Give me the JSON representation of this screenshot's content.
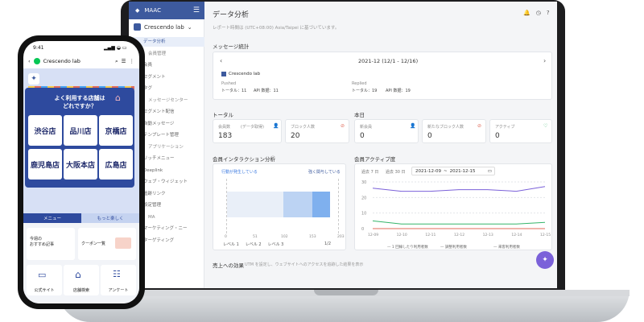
{
  "laptop": {
    "sidebar": {
      "app_name": "MAAC",
      "workspace": "Crescendo lab",
      "items": [
        {
          "label": "データ分析",
          "active": true
        },
        {
          "label": "会員管理"
        },
        {
          "label": "会員"
        },
        {
          "label": "セグメント"
        },
        {
          "label": "タグ"
        },
        {
          "label": "メッセージセンター"
        },
        {
          "label": "セグメント配信"
        },
        {
          "label": "自動メッセージ"
        },
        {
          "label": "テンプレート管理"
        },
        {
          "label": "アプリケーション"
        },
        {
          "label": "リッチメニュー"
        },
        {
          "label": "Deeplink"
        },
        {
          "label": "ウェブ・ウィジェット"
        },
        {
          "label": "追跡リンク"
        },
        {
          "label": "設定管理"
        },
        {
          "label": "MA"
        },
        {
          "label": "マーケティング・ニー"
        },
        {
          "label": "ターゲティング"
        }
      ]
    },
    "header": {
      "title": "データ分析",
      "subtitle": "レポート時間は (UTC+08:00) Asia/Taipei に基づいています。"
    },
    "message_stats": {
      "title": "メッセージ統計",
      "period": "2021-12 (12/1 - 12/16)",
      "brand": "Crescendo lab",
      "pushed_label": "Pushed",
      "pushed_total": "トータル：11",
      "pushed_api": "API 数据：11",
      "replied_label": "Replied",
      "replied_total": "トータル：19",
      "replied_api": "API 数据：19"
    },
    "totals": {
      "title": "トータル",
      "cards": [
        {
          "label": "会員数",
          "hint": "(データ取得)",
          "value": "183"
        },
        {
          "label": "ブロック人数",
          "value": "20"
        }
      ]
    },
    "today": {
      "title": "本日",
      "cards": [
        {
          "label": "新会員",
          "value": "0"
        },
        {
          "label": "新たなブロック人数",
          "value": "0"
        },
        {
          "label": "アクティブ",
          "value": "0"
        }
      ]
    },
    "interaction": {
      "title": "会員インタラクション分析",
      "legend_left": "行動が発生している",
      "legend_right": "強く関与している",
      "axis": [
        "0",
        "51",
        "102",
        "153",
        "203"
      ],
      "levels": [
        "レベル 1",
        "レベル 2",
        "レベル 3"
      ],
      "pager": "1/2"
    },
    "activity": {
      "title": "会員アクティブ度",
      "ranges": [
        "過去 7 日",
        "過去 30 日"
      ],
      "date_from": "2021-12-09",
      "date_to": "2021-12-15",
      "y_ticks": [
        "30",
        "20",
        "10",
        "0"
      ],
      "x_ticks": [
        "12-09",
        "12-10",
        "12-11",
        "12-12",
        "12-13",
        "12-14",
        "12-15"
      ],
      "legend": [
        "1 回線したり利用者数",
        "調整利用者数",
        "来客利用者数"
      ]
    },
    "footer_section": {
      "title": "売上への効果",
      "text": "UTM を設定し、ウェブサイトへのアクセスを追跡した結果を表示"
    }
  },
  "phone": {
    "time": "9:41",
    "account": "Crescendo lab",
    "banner_line1": "よく利用する店舗は",
    "banner_line2": "どれですか？",
    "stores": [
      "渋谷店",
      "品川店",
      "京橋店",
      "鹿児島店",
      "大阪本店",
      "広島店"
    ],
    "tabs": [
      "メニュー",
      "もっと楽しく"
    ],
    "menu_items": [
      {
        "label": "今週の\nおすすめ記事"
      },
      {
        "label": "クーポン一覧"
      },
      {
        "label": "公式サイト"
      },
      {
        "label": "店舗検索"
      },
      {
        "label": "アンケート"
      }
    ]
  },
  "colors": {
    "brand": "#3d5a9e",
    "phone_banner": "#2e4a9e",
    "purple": "#7b61d9",
    "green": "#35b56a"
  }
}
